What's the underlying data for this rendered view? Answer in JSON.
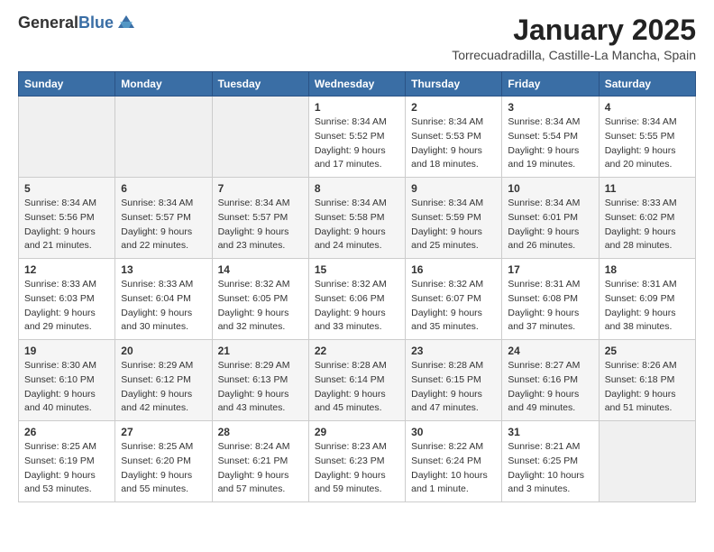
{
  "header": {
    "logo_line1": "General",
    "logo_line2": "Blue",
    "title": "January 2025",
    "subtitle": "Torrecuadradilla, Castille-La Mancha, Spain"
  },
  "calendar": {
    "days_of_week": [
      "Sunday",
      "Monday",
      "Tuesday",
      "Wednesday",
      "Thursday",
      "Friday",
      "Saturday"
    ],
    "weeks": [
      [
        {
          "day": "",
          "sunrise": "",
          "sunset": "",
          "daylight": "",
          "empty": true
        },
        {
          "day": "",
          "sunrise": "",
          "sunset": "",
          "daylight": "",
          "empty": true
        },
        {
          "day": "",
          "sunrise": "",
          "sunset": "",
          "daylight": "",
          "empty": true
        },
        {
          "day": "1",
          "sunrise": "Sunrise: 8:34 AM",
          "sunset": "Sunset: 5:52 PM",
          "daylight": "Daylight: 9 hours and 17 minutes.",
          "empty": false
        },
        {
          "day": "2",
          "sunrise": "Sunrise: 8:34 AM",
          "sunset": "Sunset: 5:53 PM",
          "daylight": "Daylight: 9 hours and 18 minutes.",
          "empty": false
        },
        {
          "day": "3",
          "sunrise": "Sunrise: 8:34 AM",
          "sunset": "Sunset: 5:54 PM",
          "daylight": "Daylight: 9 hours and 19 minutes.",
          "empty": false
        },
        {
          "day": "4",
          "sunrise": "Sunrise: 8:34 AM",
          "sunset": "Sunset: 5:55 PM",
          "daylight": "Daylight: 9 hours and 20 minutes.",
          "empty": false
        }
      ],
      [
        {
          "day": "5",
          "sunrise": "Sunrise: 8:34 AM",
          "sunset": "Sunset: 5:56 PM",
          "daylight": "Daylight: 9 hours and 21 minutes.",
          "empty": false
        },
        {
          "day": "6",
          "sunrise": "Sunrise: 8:34 AM",
          "sunset": "Sunset: 5:57 PM",
          "daylight": "Daylight: 9 hours and 22 minutes.",
          "empty": false
        },
        {
          "day": "7",
          "sunrise": "Sunrise: 8:34 AM",
          "sunset": "Sunset: 5:57 PM",
          "daylight": "Daylight: 9 hours and 23 minutes.",
          "empty": false
        },
        {
          "day": "8",
          "sunrise": "Sunrise: 8:34 AM",
          "sunset": "Sunset: 5:58 PM",
          "daylight": "Daylight: 9 hours and 24 minutes.",
          "empty": false
        },
        {
          "day": "9",
          "sunrise": "Sunrise: 8:34 AM",
          "sunset": "Sunset: 5:59 PM",
          "daylight": "Daylight: 9 hours and 25 minutes.",
          "empty": false
        },
        {
          "day": "10",
          "sunrise": "Sunrise: 8:34 AM",
          "sunset": "Sunset: 6:01 PM",
          "daylight": "Daylight: 9 hours and 26 minutes.",
          "empty": false
        },
        {
          "day": "11",
          "sunrise": "Sunrise: 8:33 AM",
          "sunset": "Sunset: 6:02 PM",
          "daylight": "Daylight: 9 hours and 28 minutes.",
          "empty": false
        }
      ],
      [
        {
          "day": "12",
          "sunrise": "Sunrise: 8:33 AM",
          "sunset": "Sunset: 6:03 PM",
          "daylight": "Daylight: 9 hours and 29 minutes.",
          "empty": false
        },
        {
          "day": "13",
          "sunrise": "Sunrise: 8:33 AM",
          "sunset": "Sunset: 6:04 PM",
          "daylight": "Daylight: 9 hours and 30 minutes.",
          "empty": false
        },
        {
          "day": "14",
          "sunrise": "Sunrise: 8:32 AM",
          "sunset": "Sunset: 6:05 PM",
          "daylight": "Daylight: 9 hours and 32 minutes.",
          "empty": false
        },
        {
          "day": "15",
          "sunrise": "Sunrise: 8:32 AM",
          "sunset": "Sunset: 6:06 PM",
          "daylight": "Daylight: 9 hours and 33 minutes.",
          "empty": false
        },
        {
          "day": "16",
          "sunrise": "Sunrise: 8:32 AM",
          "sunset": "Sunset: 6:07 PM",
          "daylight": "Daylight: 9 hours and 35 minutes.",
          "empty": false
        },
        {
          "day": "17",
          "sunrise": "Sunrise: 8:31 AM",
          "sunset": "Sunset: 6:08 PM",
          "daylight": "Daylight: 9 hours and 37 minutes.",
          "empty": false
        },
        {
          "day": "18",
          "sunrise": "Sunrise: 8:31 AM",
          "sunset": "Sunset: 6:09 PM",
          "daylight": "Daylight: 9 hours and 38 minutes.",
          "empty": false
        }
      ],
      [
        {
          "day": "19",
          "sunrise": "Sunrise: 8:30 AM",
          "sunset": "Sunset: 6:10 PM",
          "daylight": "Daylight: 9 hours and 40 minutes.",
          "empty": false
        },
        {
          "day": "20",
          "sunrise": "Sunrise: 8:29 AM",
          "sunset": "Sunset: 6:12 PM",
          "daylight": "Daylight: 9 hours and 42 minutes.",
          "empty": false
        },
        {
          "day": "21",
          "sunrise": "Sunrise: 8:29 AM",
          "sunset": "Sunset: 6:13 PM",
          "daylight": "Daylight: 9 hours and 43 minutes.",
          "empty": false
        },
        {
          "day": "22",
          "sunrise": "Sunrise: 8:28 AM",
          "sunset": "Sunset: 6:14 PM",
          "daylight": "Daylight: 9 hours and 45 minutes.",
          "empty": false
        },
        {
          "day": "23",
          "sunrise": "Sunrise: 8:28 AM",
          "sunset": "Sunset: 6:15 PM",
          "daylight": "Daylight: 9 hours and 47 minutes.",
          "empty": false
        },
        {
          "day": "24",
          "sunrise": "Sunrise: 8:27 AM",
          "sunset": "Sunset: 6:16 PM",
          "daylight": "Daylight: 9 hours and 49 minutes.",
          "empty": false
        },
        {
          "day": "25",
          "sunrise": "Sunrise: 8:26 AM",
          "sunset": "Sunset: 6:18 PM",
          "daylight": "Daylight: 9 hours and 51 minutes.",
          "empty": false
        }
      ],
      [
        {
          "day": "26",
          "sunrise": "Sunrise: 8:25 AM",
          "sunset": "Sunset: 6:19 PM",
          "daylight": "Daylight: 9 hours and 53 minutes.",
          "empty": false
        },
        {
          "day": "27",
          "sunrise": "Sunrise: 8:25 AM",
          "sunset": "Sunset: 6:20 PM",
          "daylight": "Daylight: 9 hours and 55 minutes.",
          "empty": false
        },
        {
          "day": "28",
          "sunrise": "Sunrise: 8:24 AM",
          "sunset": "Sunset: 6:21 PM",
          "daylight": "Daylight: 9 hours and 57 minutes.",
          "empty": false
        },
        {
          "day": "29",
          "sunrise": "Sunrise: 8:23 AM",
          "sunset": "Sunset: 6:23 PM",
          "daylight": "Daylight: 9 hours and 59 minutes.",
          "empty": false
        },
        {
          "day": "30",
          "sunrise": "Sunrise: 8:22 AM",
          "sunset": "Sunset: 6:24 PM",
          "daylight": "Daylight: 10 hours and 1 minute.",
          "empty": false
        },
        {
          "day": "31",
          "sunrise": "Sunrise: 8:21 AM",
          "sunset": "Sunset: 6:25 PM",
          "daylight": "Daylight: 10 hours and 3 minutes.",
          "empty": false
        },
        {
          "day": "",
          "sunrise": "",
          "sunset": "",
          "daylight": "",
          "empty": true
        }
      ]
    ]
  }
}
